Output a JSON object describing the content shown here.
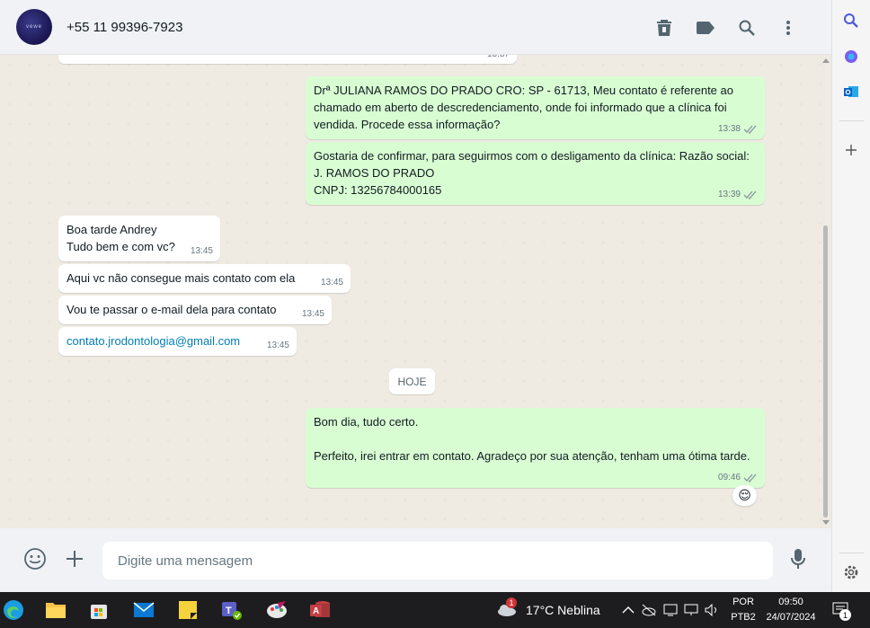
{
  "header": {
    "avatar_text": "vewe",
    "contact": "+55 11 99396-7923",
    "actions": [
      "delete-icon",
      "label-icon",
      "search-icon",
      "menu-icon"
    ]
  },
  "messages": {
    "top_partial_time": "13:37",
    "m1": {
      "text": "Drª JULIANA RAMOS DO PRADO CRO: SP - 61713, Meu contato é referente ao chamado em aberto de descredenciamento, onde foi informado que a clínica foi vendida. Procede essa informação?",
      "time": "13:38"
    },
    "m2": {
      "line1": "Gostaria de confirmar, para seguirmos com o desligamento da clínica: Razão social: J. RAMOS DO PRADO",
      "line2": "CNPJ: 13256784000165",
      "time": "13:39"
    },
    "m3": {
      "line1": "Boa tarde Andrey",
      "line2": "Tudo bem e com vc?",
      "time": "13:45"
    },
    "m4": {
      "text": "Aqui vc não consegue mais contato com ela",
      "time": "13:45"
    },
    "m5": {
      "text": "Vou te passar o e-mail dela para contato",
      "time": "13:45"
    },
    "m6": {
      "text": "contato.jrodontologia@gmail.com",
      "time": "13:45"
    },
    "date_divider": "HOJE",
    "m7": {
      "line1": "Bom dia, tudo certo.",
      "line2": "Perfeito, irei entrar em contato. Agradeço por sua atenção, tenham uma ótima tarde.",
      "time": "09:46",
      "reaction": "😌"
    }
  },
  "composer": {
    "placeholder": "Digite uma mensagem"
  },
  "side": {
    "icons": [
      "search-icon",
      "copilot-icon",
      "outlook-icon",
      "add-icon",
      "settings-icon"
    ]
  },
  "taskbar": {
    "weather_badge": "1",
    "weather": "17°C  Neblina",
    "lang1": "POR",
    "lang2": "PTB2",
    "time": "09:50",
    "date": "24/07/2024",
    "notif_count": "1"
  },
  "colors": {
    "outgoing": "#d9fdd3",
    "incoming": "#ffffff",
    "background": "#efeae2",
    "link": "#027eb5"
  }
}
